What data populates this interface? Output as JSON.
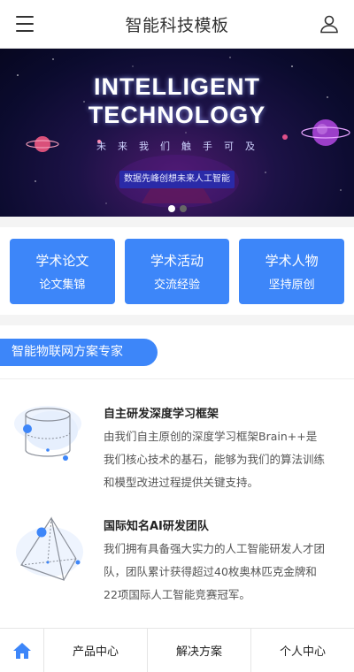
{
  "header": {
    "title": "智能科技模板"
  },
  "banner": {
    "title_line1": "INTELLIGENT",
    "title_line2": "TECHNOLOGY",
    "subtitle": "未来我们触手可及",
    "tagline": "数据先峰创想未来人工智能",
    "slide_count": 2,
    "active_slide": 1
  },
  "tiles": [
    {
      "title": "学术论文",
      "subtitle": "论文集锦"
    },
    {
      "title": "学术活动",
      "subtitle": "交流经验"
    },
    {
      "title": "学术人物",
      "subtitle": "坚持原创"
    }
  ],
  "section": {
    "title": "智能物联网方案专家"
  },
  "features": [
    {
      "title": "自主研发深度学习框架",
      "desc": "由我们自主原创的深度学习框架Brain++是我们核心技术的基石，能够为我们的算法训练和模型改进过程提供关键支持。",
      "icon": "cylinder-icon"
    },
    {
      "title": "国际知名AI研发团队",
      "desc": "我们拥有具备强大实力的人工智能研发人才团队，团队累计获得超过40枚奥林匹克金牌和22项国际人工智能竞赛冠军。",
      "icon": "pyramid-icon"
    }
  ],
  "nav": {
    "items": [
      "产品中心",
      "解决方案",
      "个人中心"
    ]
  },
  "colors": {
    "accent": "#3d86f9"
  }
}
